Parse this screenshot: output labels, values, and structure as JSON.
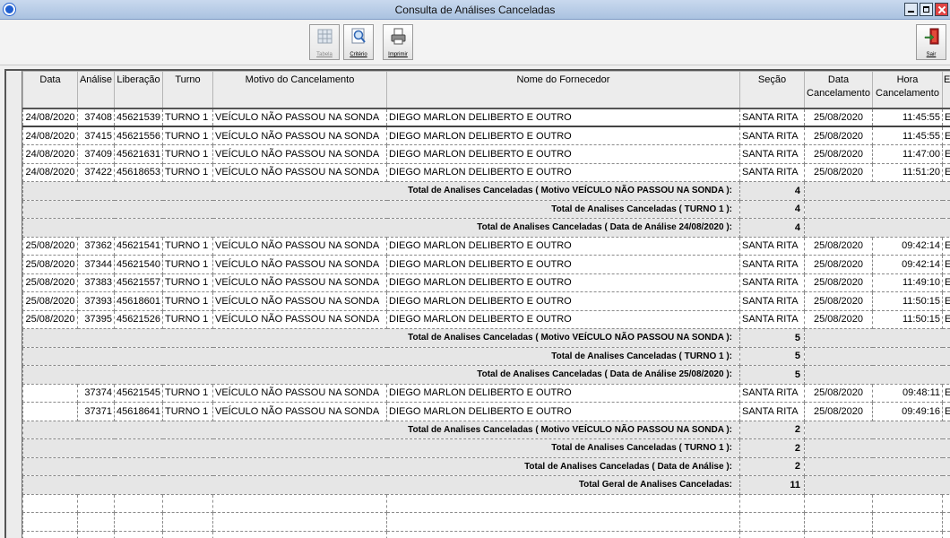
{
  "window": {
    "title": "Consulta de Análises Canceladas"
  },
  "toolbar": {
    "tabela": {
      "label": "Tabela",
      "icon": "table-icon"
    },
    "criterio": {
      "label": "Critério",
      "icon": "magnifier-icon"
    },
    "imprimir": {
      "label": "Imprimir",
      "icon": "printer-icon"
    },
    "sair": {
      "label": "Sair",
      "icon": "exit-door-icon"
    }
  },
  "columns": [
    "Data",
    "Análise",
    "Liberação",
    "Turno",
    "Motivo do Cancelamento",
    "Nome do Fornecedor",
    "Seção",
    "Data Cancelamento",
    "Hora Cancelamento",
    "E"
  ],
  "rows": [
    {
      "type": "data",
      "data": "24/08/2020",
      "analise": "37408",
      "liberacao": "45621539",
      "turno": "TURNO 1",
      "motivo": "VEÍCULO NÃO PASSOU NA SONDA",
      "fornecedor": "DIEGO MARLON DELIBERTO E OUTRO",
      "secao": "SANTA RITA",
      "data_canc": "25/08/2020",
      "hora_canc": "11:45:55",
      "extra": "E"
    },
    {
      "type": "data",
      "data": "24/08/2020",
      "analise": "37415",
      "liberacao": "45621556",
      "turno": "TURNO 1",
      "motivo": "VEÍCULO NÃO PASSOU NA SONDA",
      "fornecedor": "DIEGO MARLON DELIBERTO E OUTRO",
      "secao": "SANTA RITA",
      "data_canc": "25/08/2020",
      "hora_canc": "11:45:55",
      "extra": "E"
    },
    {
      "type": "data",
      "data": "24/08/2020",
      "analise": "37409",
      "liberacao": "45621631",
      "turno": "TURNO 1",
      "motivo": "VEÍCULO NÃO PASSOU NA SONDA",
      "fornecedor": "DIEGO MARLON DELIBERTO E OUTRO",
      "secao": "SANTA RITA",
      "data_canc": "25/08/2020",
      "hora_canc": "11:47:00",
      "extra": "E"
    },
    {
      "type": "data",
      "data": "24/08/2020",
      "analise": "37422",
      "liberacao": "45618653",
      "turno": "TURNO 1",
      "motivo": "VEÍCULO NÃO PASSOU NA SONDA",
      "fornecedor": "DIEGO MARLON DELIBERTO E OUTRO",
      "secao": "SANTA RITA",
      "data_canc": "25/08/2020",
      "hora_canc": "11:51:20",
      "extra": "E"
    },
    {
      "type": "total",
      "label": "Total de Analises Canceladas ( Motivo VEÍCULO NÃO PASSOU NA SONDA ):",
      "value": "4"
    },
    {
      "type": "total",
      "label": "Total de Analises Canceladas ( TURNO 1 ):",
      "value": "4"
    },
    {
      "type": "total",
      "label": "Total de Analises Canceladas ( Data de Análise 24/08/2020 ):",
      "value": "4"
    },
    {
      "type": "data",
      "data": "25/08/2020",
      "analise": "37362",
      "liberacao": "45621541",
      "turno": "TURNO 1",
      "motivo": "VEÍCULO NÃO PASSOU NA SONDA",
      "fornecedor": "DIEGO MARLON DELIBERTO E OUTRO",
      "secao": "SANTA RITA",
      "data_canc": "25/08/2020",
      "hora_canc": "09:42:14",
      "extra": "E"
    },
    {
      "type": "data",
      "data": "25/08/2020",
      "analise": "37344",
      "liberacao": "45621540",
      "turno": "TURNO 1",
      "motivo": "VEÍCULO NÃO PASSOU NA SONDA",
      "fornecedor": "DIEGO MARLON DELIBERTO E OUTRO",
      "secao": "SANTA RITA",
      "data_canc": "25/08/2020",
      "hora_canc": "09:42:14",
      "extra": "E"
    },
    {
      "type": "data",
      "data": "25/08/2020",
      "analise": "37383",
      "liberacao": "45621557",
      "turno": "TURNO 1",
      "motivo": "VEÍCULO NÃO PASSOU NA SONDA",
      "fornecedor": "DIEGO MARLON DELIBERTO E OUTRO",
      "secao": "SANTA RITA",
      "data_canc": "25/08/2020",
      "hora_canc": "11:49:10",
      "extra": "E"
    },
    {
      "type": "data",
      "data": "25/08/2020",
      "analise": "37393",
      "liberacao": "45618601",
      "turno": "TURNO 1",
      "motivo": "VEÍCULO NÃO PASSOU NA SONDA",
      "fornecedor": "DIEGO MARLON DELIBERTO E OUTRO",
      "secao": "SANTA RITA",
      "data_canc": "25/08/2020",
      "hora_canc": "11:50:15",
      "extra": "E"
    },
    {
      "type": "data",
      "data": "25/08/2020",
      "analise": "37395",
      "liberacao": "45621526",
      "turno": "TURNO 1",
      "motivo": "VEÍCULO NÃO PASSOU NA SONDA",
      "fornecedor": "DIEGO MARLON DELIBERTO E OUTRO",
      "secao": "SANTA RITA",
      "data_canc": "25/08/2020",
      "hora_canc": "11:50:15",
      "extra": "E"
    },
    {
      "type": "total",
      "label": "Total de Analises Canceladas ( Motivo VEÍCULO NÃO PASSOU NA SONDA ):",
      "value": "5"
    },
    {
      "type": "total",
      "label": "Total de Analises Canceladas ( TURNO 1 ):",
      "value": "5"
    },
    {
      "type": "total",
      "label": "Total de Analises Canceladas ( Data de Análise 25/08/2020 ):",
      "value": "5"
    },
    {
      "type": "data",
      "data": "",
      "analise": "37374",
      "liberacao": "45621545",
      "turno": "TURNO 1",
      "motivo": "VEÍCULO NÃO PASSOU NA SONDA",
      "fornecedor": "DIEGO MARLON DELIBERTO E OUTRO",
      "secao": "SANTA RITA",
      "data_canc": "25/08/2020",
      "hora_canc": "09:48:11",
      "extra": "E"
    },
    {
      "type": "data",
      "data": "",
      "analise": "37371",
      "liberacao": "45618641",
      "turno": "TURNO 1",
      "motivo": "VEÍCULO NÃO PASSOU NA SONDA",
      "fornecedor": "DIEGO MARLON DELIBERTO E OUTRO",
      "secao": "SANTA RITA",
      "data_canc": "25/08/2020",
      "hora_canc": "09:49:16",
      "extra": "E"
    },
    {
      "type": "total",
      "label": "Total de Analises Canceladas ( Motivo VEÍCULO NÃO PASSOU NA SONDA ):",
      "value": "2"
    },
    {
      "type": "total",
      "label": "Total de Analises Canceladas ( TURNO 1 ):",
      "value": "2"
    },
    {
      "type": "total",
      "label": "Total de Analises Canceladas ( Data de Análise  ):",
      "value": "2"
    },
    {
      "type": "total",
      "label": "Total Geral de Analises Canceladas:",
      "value": "11"
    },
    {
      "type": "empty"
    },
    {
      "type": "empty"
    },
    {
      "type": "empty"
    }
  ]
}
